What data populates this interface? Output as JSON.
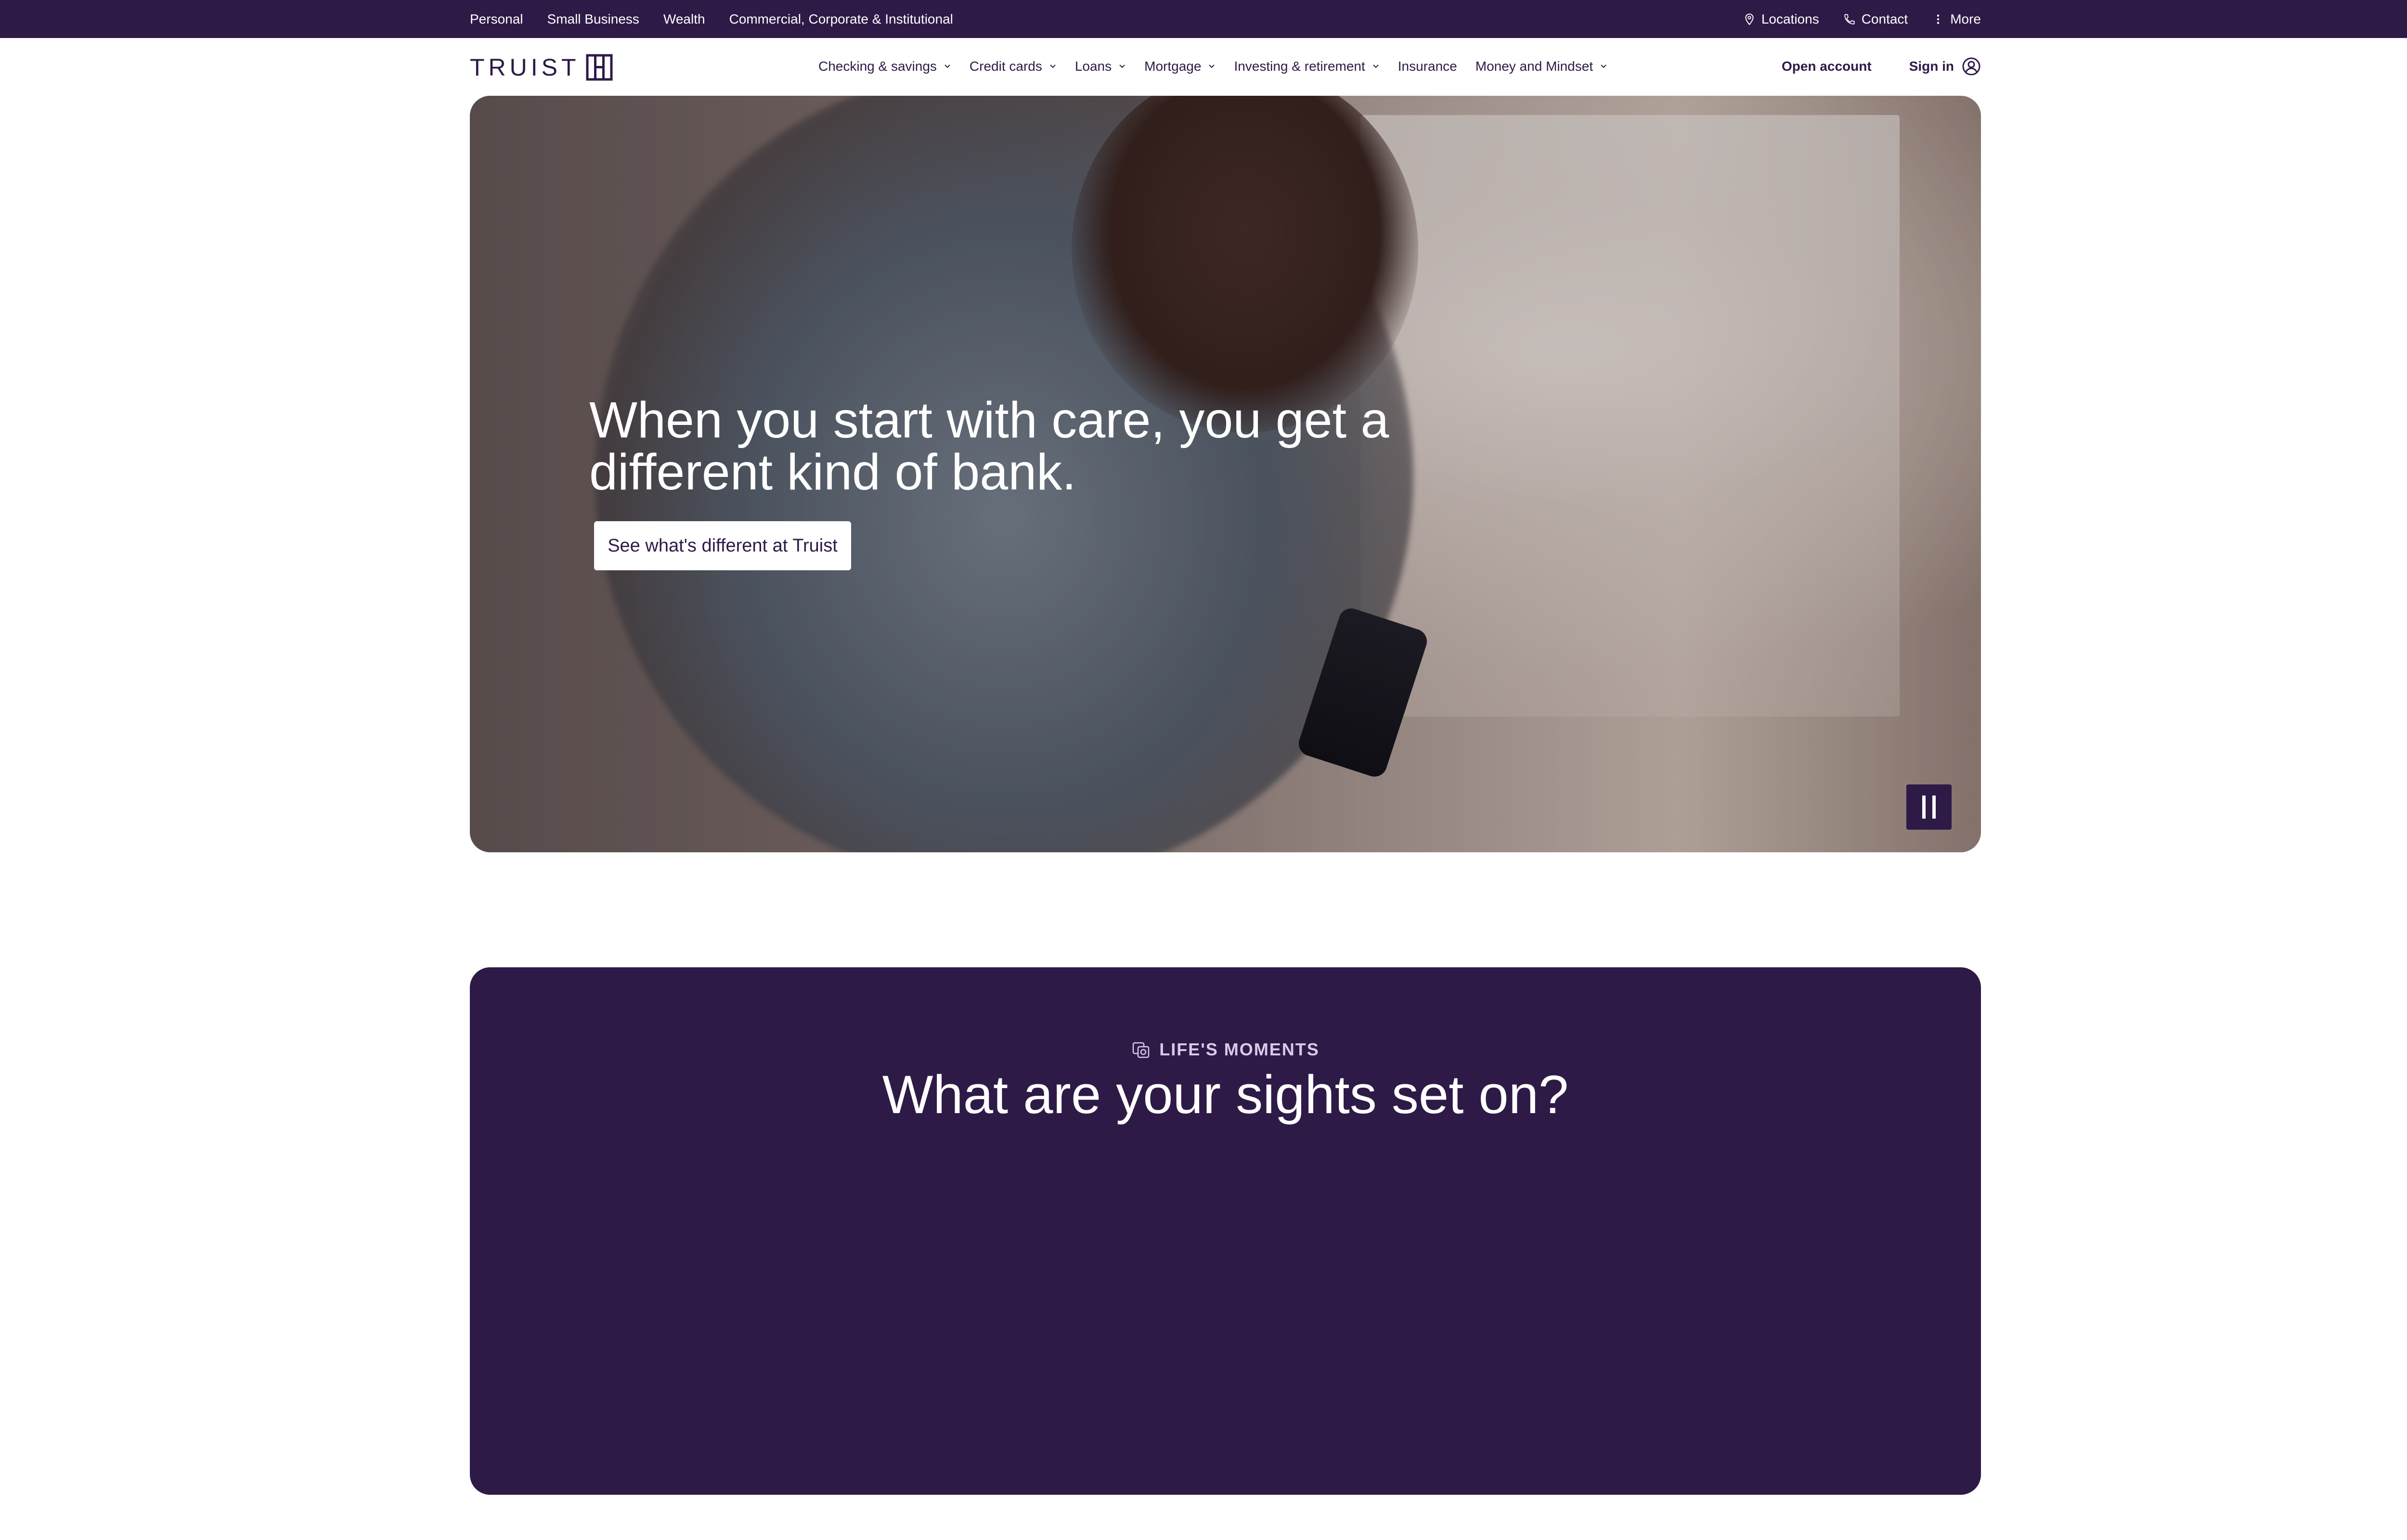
{
  "utility": {
    "segments": [
      "Personal",
      "Small Business",
      "Wealth",
      "Commercial, Corporate & Institutional"
    ],
    "locations": "Locations",
    "contact": "Contact",
    "more": "More"
  },
  "nav": {
    "logo_text": "TRUIST",
    "items": [
      {
        "label": "Checking & savings",
        "dropdown": true
      },
      {
        "label": "Credit cards",
        "dropdown": true
      },
      {
        "label": "Loans",
        "dropdown": true
      },
      {
        "label": "Mortgage",
        "dropdown": true
      },
      {
        "label": "Investing & retirement",
        "dropdown": true
      },
      {
        "label": "Insurance",
        "dropdown": false
      },
      {
        "label": "Money and Mindset",
        "dropdown": true
      }
    ],
    "open_account": "Open account",
    "sign_in": "Sign in"
  },
  "hero": {
    "title": "When you start with care, you get a different kind of bank.",
    "cta": "See what's different at Truist"
  },
  "moments": {
    "eyebrow": "LIFE'S MOMENTS",
    "title": "What are your sights set on?"
  },
  "colors": {
    "brand": "#2e1a47",
    "white": "#ffffff",
    "eyebrow": "#d6cbe8"
  }
}
